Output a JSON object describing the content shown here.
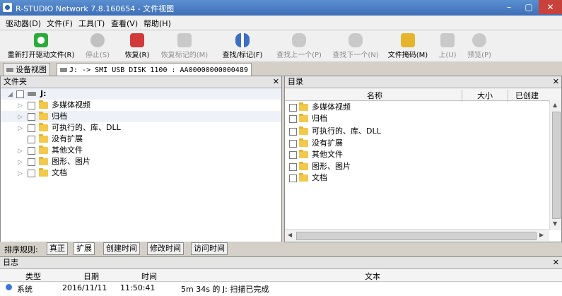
{
  "window": {
    "title": "R-STUDIO Network 7.8.160654 - 文件视图",
    "min": "–",
    "max": "▢",
    "close": "✕"
  },
  "menu": [
    "驱动器(D)",
    "文件(F)",
    "工具(T)",
    "查看(V)",
    "帮助(H)"
  ],
  "toolbar": [
    {
      "label": "重新打开驱动文件(R)",
      "icon": "refresh-icon",
      "enabled": true,
      "color": "#2bab3a"
    },
    {
      "label": "停止(S)",
      "icon": "stop-icon",
      "enabled": false,
      "color": "#888888"
    },
    {
      "label": "恢复(R)",
      "icon": "recover-icon",
      "enabled": true,
      "color": "#d23a3a"
    },
    {
      "label": "恢复标记的(M)",
      "icon": "recover-marked-icon",
      "enabled": false,
      "color": "#888888"
    },
    {
      "label": "查找/标记(F)",
      "icon": "binoculars-icon",
      "enabled": true,
      "color": "#3d6fc2"
    },
    {
      "label": "查找上一个(P)",
      "icon": "find-prev-icon",
      "enabled": false,
      "color": "#888888"
    },
    {
      "label": "查找下一个(N)",
      "icon": "find-next-icon",
      "enabled": false,
      "color": "#888888"
    },
    {
      "label": "文件掩码(M)",
      "icon": "mask-icon",
      "enabled": true,
      "color": "#e6b52c"
    },
    {
      "label": "上(U)",
      "icon": "up-folder-icon",
      "enabled": false,
      "color": "#888888"
    },
    {
      "label": "预览(P)",
      "icon": "preview-icon",
      "enabled": false,
      "color": "#888888"
    }
  ],
  "tabs": {
    "device_view": "设备视图",
    "drive_tab": "J: -> SMI USB DISK 1100 : AA00000000000489"
  },
  "folders_panel": {
    "title": "文件夹",
    "root": "J:",
    "items": [
      "多媒体视频",
      "归档",
      "可执行的、库、DLL",
      "没有扩展",
      "其他文件",
      "图形、图片",
      "文档"
    ]
  },
  "list_panel": {
    "title": "目录",
    "columns": {
      "name": "名称",
      "size": "大小",
      "created": "已创建"
    },
    "items": [
      "多媒体视频",
      "归档",
      "可执行的、库、DLL",
      "没有扩展",
      "其他文件",
      "图形、图片",
      "文档"
    ]
  },
  "sort": {
    "label": "排序规则:",
    "buttons": [
      "真正",
      "扩展",
      "创建时间",
      "修改时间",
      "访问时间"
    ],
    "active": "扩展"
  },
  "log": {
    "title": "日志",
    "columns": {
      "type": "类型",
      "date": "日期",
      "time": "时间",
      "text": "文本"
    },
    "rows": [
      {
        "type": "系统",
        "date": "2016/11/11",
        "time": "11:50:41",
        "text": "5m 34s 的 J: 扫描已完成"
      }
    ]
  },
  "colors": {
    "accent": "#3e6fb8",
    "folder": "#f2c94c"
  }
}
